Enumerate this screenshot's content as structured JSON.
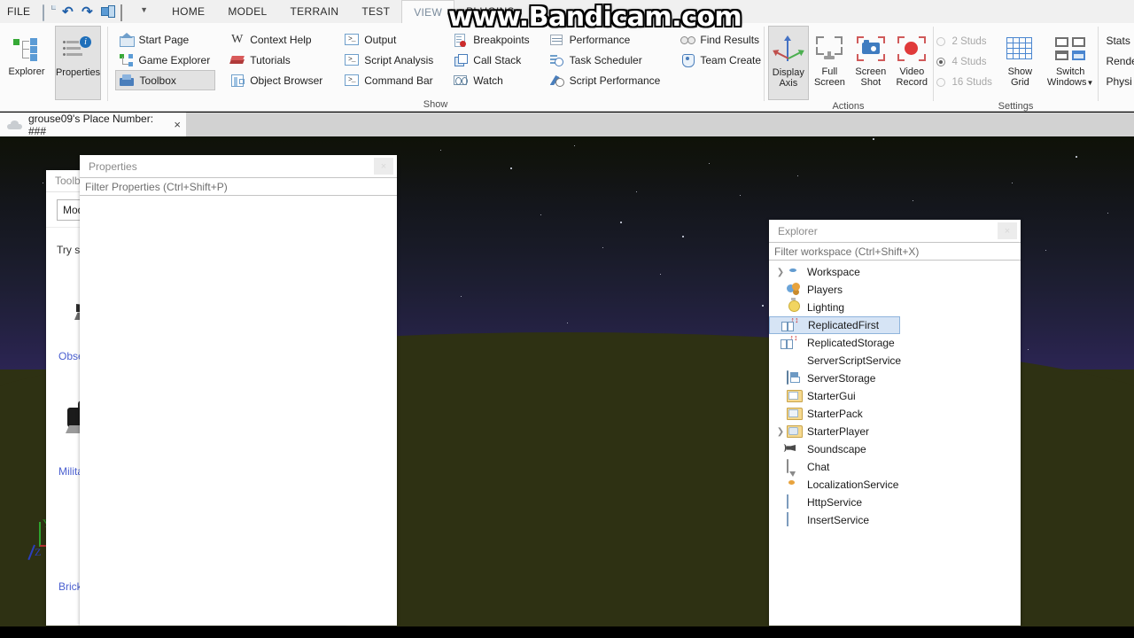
{
  "app": {
    "file_menu": "FILE",
    "tabs": [
      {
        "label": "HOME",
        "active": false
      },
      {
        "label": "MODEL",
        "active": false
      },
      {
        "label": "TERRAIN",
        "active": false
      },
      {
        "label": "TEST",
        "active": false
      },
      {
        "label": "VIEW",
        "active": true
      },
      {
        "label": "PLUGINS",
        "active": false
      }
    ],
    "quick_access": [
      {
        "icon": "new-document-icon"
      },
      {
        "icon": "undo-icon"
      },
      {
        "icon": "redo-icon"
      },
      {
        "icon": "widget-icon"
      },
      {
        "icon": "stop-square-icon"
      },
      {
        "icon": "chevron-down-icon"
      }
    ]
  },
  "ribbon": {
    "groups": [
      {
        "name": "panels",
        "label": "",
        "big_buttons": [
          {
            "label_line1": "Explorer",
            "label_line2": "",
            "icon": "explorer-icon",
            "selected": false
          },
          {
            "label_line1": "Properties",
            "label_line2": "",
            "icon": "properties-icon",
            "selected": false
          }
        ]
      },
      {
        "name": "show",
        "label": "Show",
        "columns": [
          [
            {
              "label": "Start Page",
              "icon": "home-icon",
              "selected": false
            },
            {
              "label": "Game Explorer",
              "icon": "game-explorer-icon",
              "selected": false
            },
            {
              "label": "Toolbox",
              "icon": "toolbox-icon",
              "selected": true
            }
          ],
          [
            {
              "label": "Context Help",
              "icon": "wiki-w-icon",
              "selected": false
            },
            {
              "label": "Tutorials",
              "icon": "books-icon",
              "selected": false
            },
            {
              "label": "Object Browser",
              "icon": "object-browser-icon",
              "selected": false
            }
          ],
          [
            {
              "label": "Output",
              "icon": "console-icon",
              "selected": false
            },
            {
              "label": "Script Analysis",
              "icon": "console-icon",
              "selected": false
            },
            {
              "label": "Command Bar",
              "icon": "console-icon",
              "selected": false
            }
          ],
          [
            {
              "label": "Breakpoints",
              "icon": "breakpoint-icon",
              "selected": false
            },
            {
              "label": "Call Stack",
              "icon": "call-stack-icon",
              "selected": false
            },
            {
              "label": "Watch",
              "icon": "watch-icon",
              "selected": false
            }
          ],
          [
            {
              "label": "Performance",
              "icon": "performance-icon",
              "selected": false
            },
            {
              "label": "Task Scheduler",
              "icon": "task-scheduler-icon",
              "selected": false
            },
            {
              "label": "Script Performance",
              "icon": "script-performance-icon",
              "selected": false
            }
          ],
          [
            {
              "label": "Find Results",
              "icon": "find-results-icon",
              "selected": false
            },
            {
              "label": "Team Create",
              "icon": "team-create-icon",
              "selected": false
            }
          ]
        ]
      },
      {
        "name": "actions",
        "label": "Actions",
        "buttons": [
          {
            "label_line1": "Display",
            "label_line2": "Axis",
            "icon": "display-axis-icon",
            "selected": true
          },
          {
            "label_line1": "Full",
            "label_line2": "Screen",
            "icon": "full-screen-icon",
            "selected": false
          },
          {
            "label_line1": "Screen",
            "label_line2": "Shot",
            "icon": "screen-shot-icon",
            "selected": false
          },
          {
            "label_line1": "Video",
            "label_line2": "Record",
            "icon": "video-record-icon",
            "selected": false
          }
        ]
      },
      {
        "name": "settings",
        "label": "Settings",
        "stud_options": [
          {
            "label": "2 Studs",
            "selected": false
          },
          {
            "label": "4 Studs",
            "selected": true
          },
          {
            "label": "16 Studs",
            "selected": false
          }
        ],
        "buttons": [
          {
            "label_line1": "Show",
            "label_line2": "Grid",
            "icon": "show-grid-icon"
          },
          {
            "label_line1": "Switch",
            "label_line2": "Windows",
            "icon": "switch-windows-icon",
            "has_caret": true
          }
        ]
      },
      {
        "name": "stats",
        "label": "",
        "items": [
          {
            "label": "Stats"
          },
          {
            "label": "Rende"
          },
          {
            "label": "Physi"
          }
        ]
      }
    ]
  },
  "watermark": {
    "text": "www.Bandicam.com"
  },
  "document_tab": {
    "title": "grouse09's Place Number: ###",
    "icon": "cloud-icon",
    "close_label": "×"
  },
  "toolbox": {
    "title": "Toolb",
    "category_value": "Mod",
    "search_placeholder": "Try s",
    "items": [
      {
        "name": "Obse",
        "model": "observation-model"
      },
      {
        "name": "Milita",
        "model": "military-model"
      },
      {
        "name": "Brick",
        "model": "brick-model"
      }
    ]
  },
  "properties": {
    "title": "Properties",
    "filter_placeholder": "Filter Properties (Ctrl+Shift+P)",
    "close_label": "×"
  },
  "explorer": {
    "title": "Explorer",
    "filter_placeholder": "Filter workspace (Ctrl+Shift+X)",
    "close_label": "×",
    "tree": [
      {
        "label": "Workspace",
        "icon": "workspace-icon",
        "expandable": true,
        "selected": false
      },
      {
        "label": "Players",
        "icon": "players-icon",
        "expandable": false,
        "selected": false
      },
      {
        "label": "Lighting",
        "icon": "lighting-icon",
        "expandable": false,
        "selected": false
      },
      {
        "label": "ReplicatedFirst",
        "icon": "replicated-icon",
        "expandable": false,
        "selected": true
      },
      {
        "label": "ReplicatedStorage",
        "icon": "replicated-icon",
        "expandable": false,
        "selected": false
      },
      {
        "label": "ServerScriptService",
        "icon": "server-script-service-icon",
        "expandable": false,
        "selected": false
      },
      {
        "label": "ServerStorage",
        "icon": "server-storage-icon",
        "expandable": false,
        "selected": false
      },
      {
        "label": "StarterGui",
        "icon": "folder-gui-icon",
        "expandable": false,
        "selected": false
      },
      {
        "label": "StarterPack",
        "icon": "folder-pack-icon",
        "expandable": false,
        "selected": false
      },
      {
        "label": "StarterPlayer",
        "icon": "folder-player-icon",
        "expandable": true,
        "selected": false
      },
      {
        "label": "Soundscape",
        "icon": "sound-icon",
        "expandable": false,
        "selected": false
      },
      {
        "label": "Chat",
        "icon": "chat-icon",
        "expandable": false,
        "selected": false
      },
      {
        "label": "LocalizationService",
        "icon": "localization-icon",
        "expandable": false,
        "selected": false
      },
      {
        "label": "HttpService",
        "icon": "box-icon",
        "expandable": false,
        "selected": false
      },
      {
        "label": "InsertService",
        "icon": "box-icon",
        "expandable": false,
        "selected": false
      }
    ]
  },
  "viewport": {
    "axis_labels": {
      "y": "Y",
      "z": "Z"
    },
    "colors": {
      "sky_top": "#0f1208",
      "sky_bottom": "#2b4a9e",
      "ground": "#2e3113",
      "axis_x": "#b33030",
      "axis_y": "#2ea32e",
      "axis_z": "#2b3fc0"
    }
  }
}
